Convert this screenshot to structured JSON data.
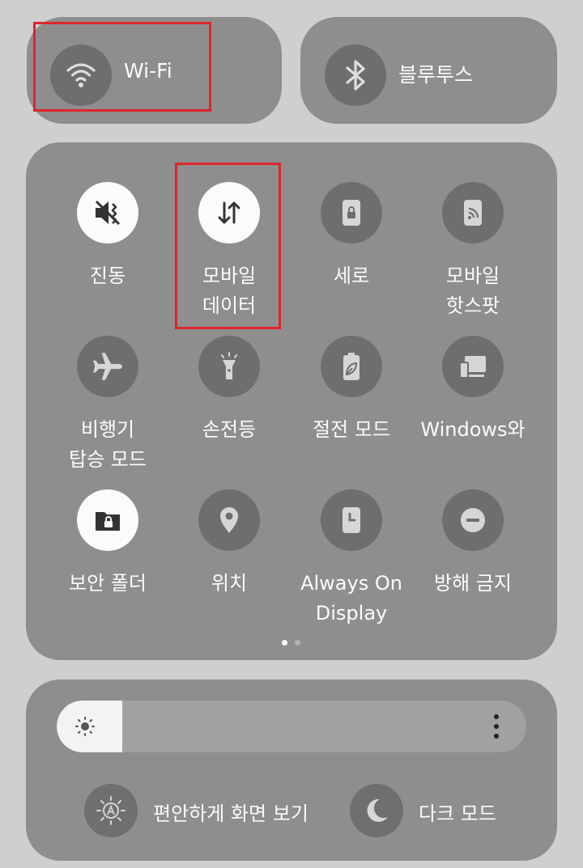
{
  "top_tiles": {
    "wifi": {
      "label": "Wi-Fi",
      "icon": "wifi-icon",
      "state": "off"
    },
    "bluetooth": {
      "label": "블루투스",
      "icon": "bluetooth-icon",
      "state": "off"
    }
  },
  "quick_tiles": [
    {
      "label": "진동",
      "icon": "vibrate-icon",
      "state": "on"
    },
    {
      "label": "모바일\n데이터",
      "icon": "mobile-data-icon",
      "state": "on"
    },
    {
      "label": "세로",
      "icon": "portrait-lock-icon",
      "state": "off"
    },
    {
      "label": "모바일\n핫스팟",
      "icon": "hotspot-icon",
      "state": "off"
    },
    {
      "label": "비행기\n탑승 모드",
      "icon": "airplane-icon",
      "state": "off"
    },
    {
      "label": "손전등",
      "icon": "flashlight-icon",
      "state": "off"
    },
    {
      "label": "절전 모드",
      "icon": "power-saving-icon",
      "state": "off"
    },
    {
      "label": "Windows와",
      "icon": "link-to-windows-icon",
      "state": "off"
    },
    {
      "label": "보안 폴더",
      "icon": "secure-folder-icon",
      "state": "on"
    },
    {
      "label": "위치",
      "icon": "location-icon",
      "state": "off"
    },
    {
      "label": "Always On\nDisplay",
      "icon": "always-on-display-icon",
      "state": "off"
    },
    {
      "label": "방해 금지",
      "icon": "do-not-disturb-icon",
      "state": "off"
    }
  ],
  "pagination": {
    "pages": 2,
    "current": 1
  },
  "brightness": {
    "level": 0.14,
    "icon": "sun-icon",
    "menu_icon": "more-vertical-icon"
  },
  "bottom_actions": [
    {
      "label": "편안하게 화면 보기",
      "icon": "eye-comfort-icon"
    },
    {
      "label": "다크 모드",
      "icon": "moon-icon"
    }
  ],
  "colors": {
    "panel": "#8e8e8e",
    "icon_off": "#6e6e6e",
    "icon_on": "#fbfbfb",
    "highlight": "#e0242e"
  }
}
